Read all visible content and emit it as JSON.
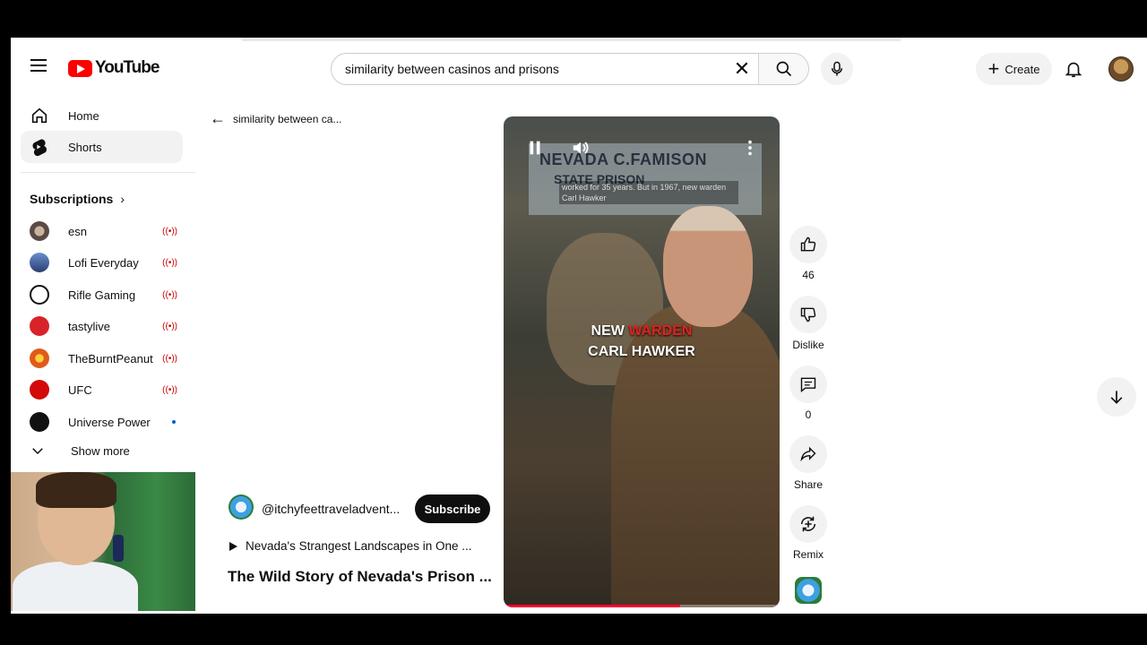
{
  "header": {
    "logo_text": "YouTube",
    "search_value": "similarity between casinos and prisons",
    "create_label": "Create"
  },
  "sidebar": {
    "items": [
      {
        "label": "Home"
      },
      {
        "label": "Shorts"
      }
    ],
    "subscriptions_title": "Subscriptions",
    "subscriptions": [
      {
        "name": "esn",
        "status": "live"
      },
      {
        "name": "Lofi Everyday",
        "status": "live"
      },
      {
        "name": "Rifle Gaming",
        "status": "live"
      },
      {
        "name": "tastylive",
        "status": "live"
      },
      {
        "name": "TheBurntPeanut",
        "status": "live"
      },
      {
        "name": "UFC",
        "status": "live"
      },
      {
        "name": "Universe Power",
        "status": "new"
      }
    ],
    "show_more": "Show more"
  },
  "back_text": "similarity between ca...",
  "video": {
    "sign_line1": "NEVADA C.FAMISON",
    "sign_line2": "STATE PRISON",
    "caption_overlay": "worked for 35 years. But in 1967, new warden Carl Hawker",
    "caption_line1_a": "NEW ",
    "caption_line1_b": "WARDEN",
    "caption_line2": "CARL HAWKER",
    "progress": 0.64
  },
  "channel": {
    "handle": "@itchyfeettraveladvent...",
    "subscribe_label": "Subscribe",
    "related": "Nevada's Strangest Landscapes in One ...",
    "title": "The Wild Story of Nevada's Prison ..."
  },
  "actions": {
    "likes": "46",
    "dislike": "Dislike",
    "comments": "0",
    "share": "Share",
    "remix": "Remix"
  }
}
